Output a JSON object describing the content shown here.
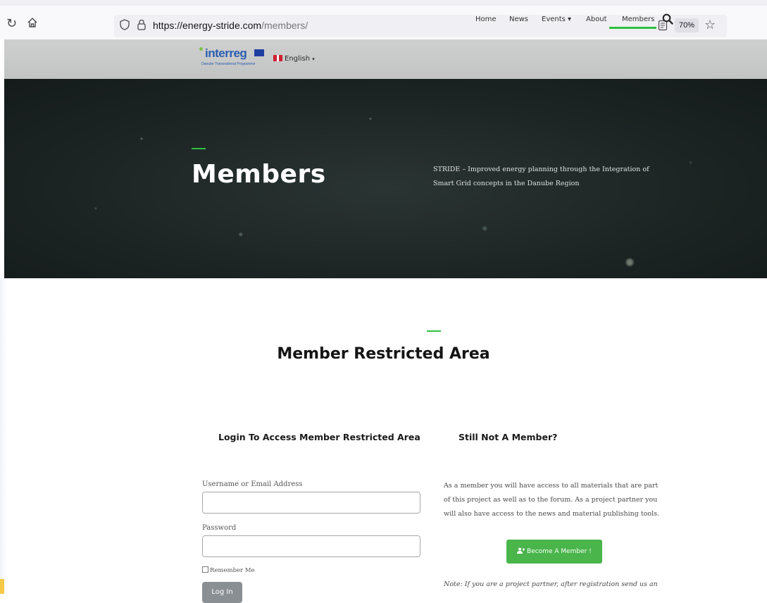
{
  "browser": {
    "url_domain": "https://energy-stride.com",
    "url_path": "/members/",
    "zoom": "70%"
  },
  "header": {
    "logo_text": "interreg",
    "logo_subtitle": "Danube Transnational Programme",
    "language": "English",
    "nav": [
      "Home",
      "News",
      "Events",
      "About",
      "Members"
    ],
    "events_caret": "▾"
  },
  "hero": {
    "title": "Members",
    "description": "STRIDE – Improved energy planning through the Integration of Smart Grid concepts in the Danube Region"
  },
  "section": {
    "title": "Member Restricted Area"
  },
  "login": {
    "heading": "Login To Access Member Restricted Area",
    "username_label": "Username or Email Address",
    "password_label": "Password",
    "remember_label": "Remember Me",
    "button": "Log In"
  },
  "signup": {
    "heading": "Still Not A Member?",
    "text": "As a member you will have access to all materials that are part of this project as well as to the forum. As a project partner you will also have access to the news and material publishing tools.",
    "button": "Become A Member !",
    "note": "Note: If you are a project partner, after registration send us an"
  },
  "colors": {
    "accent_green": "#2ec03e",
    "button_green": "#49b54b",
    "hero_bg": "#1c2423"
  }
}
